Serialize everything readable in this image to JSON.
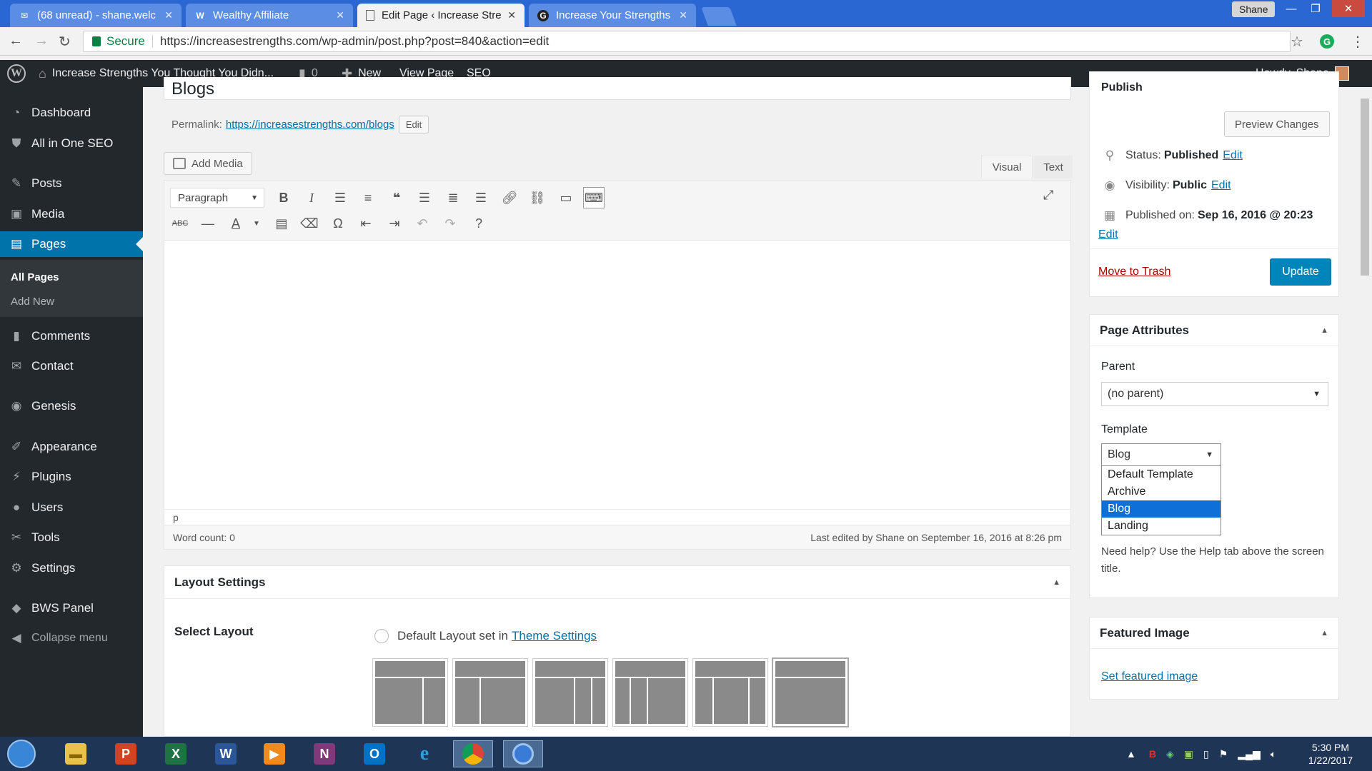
{
  "browser": {
    "tabs": [
      {
        "label": "(68 unread) - shane.welc",
        "icon": "gmail-icon"
      },
      {
        "label": "Wealthy Affiliate",
        "icon": "wa-icon"
      },
      {
        "label": "Edit Page ‹ Increase Stre",
        "icon": "page-icon"
      },
      {
        "label": "Increase Your Strengths",
        "icon": "g-icon"
      }
    ],
    "window_user": "Shane",
    "secure_label": "Secure",
    "url": "https://increasestrengths.com/wp-admin/post.php?post=840&action=edit"
  },
  "adminbar": {
    "site_name": "Increase Strengths You Thought You Didn...",
    "comments_count": "0",
    "new_label": "New",
    "view_page_label": "View Page",
    "seo_label": "SEO",
    "howdy": "Howdy, Shane"
  },
  "sidebar": {
    "items": [
      {
        "label": "Dashboard",
        "icon": "dashboard-icon"
      },
      {
        "label": "All in One SEO",
        "icon": "seo-icon"
      },
      {
        "label": "Posts",
        "icon": "pin-icon"
      },
      {
        "label": "Media",
        "icon": "media-icon"
      },
      {
        "label": "Pages",
        "icon": "pages-icon"
      },
      {
        "label": "Comments",
        "icon": "comment-icon"
      },
      {
        "label": "Contact",
        "icon": "mail-icon"
      },
      {
        "label": "Genesis",
        "icon": "genesis-icon"
      },
      {
        "label": "Appearance",
        "icon": "brush-icon"
      },
      {
        "label": "Plugins",
        "icon": "plugin-icon"
      },
      {
        "label": "Users",
        "icon": "user-icon"
      },
      {
        "label": "Tools",
        "icon": "wrench-icon"
      },
      {
        "label": "Settings",
        "icon": "settings-icon"
      },
      {
        "label": "BWS Panel",
        "icon": "bws-icon"
      }
    ],
    "submenu": [
      "All Pages",
      "Add New"
    ],
    "collapse": "Collapse menu"
  },
  "editor": {
    "title": "Blogs",
    "permalink_label": "Permalink:",
    "permalink_url": "https://increasestrengths.com/blogs",
    "permalink_edit": "Edit",
    "add_media": "Add Media",
    "tab_visual": "Visual",
    "tab_text": "Text",
    "format": "Paragraph",
    "path": "p",
    "word_count": "Word count: 0",
    "last_edited": "Last edited by Shane on September 16, 2016 at 8:26 pm"
  },
  "layout": {
    "title": "Layout Settings",
    "select_label": "Select Layout",
    "default_text": "Default Layout set in",
    "theme_settings_link": "Theme Settings"
  },
  "publish": {
    "title": "Publish",
    "preview": "Preview Changes",
    "status_label": "Status:",
    "status_value": "Published",
    "visibility_label": "Visibility:",
    "visibility_value": "Public",
    "published_label": "Published on:",
    "published_value": "Sep 16, 2016 @ 20:23",
    "edit": "Edit",
    "trash": "Move to Trash",
    "update": "Update"
  },
  "attributes": {
    "title": "Page Attributes",
    "parent_label": "Parent",
    "parent_value": "(no parent)",
    "template_label": "Template",
    "template_value": "Blog",
    "template_options": [
      "Default Template",
      "Archive",
      "Blog",
      "Landing"
    ],
    "selected_option": "Blog",
    "help": "Need help? Use the Help tab above the screen title."
  },
  "featured": {
    "title": "Featured Image",
    "link": "Set featured image"
  },
  "taskbar": {
    "time": "5:30 PM",
    "date": "1/22/2017"
  },
  "colors": {
    "wp_blue": "#0073aa",
    "admin_dark": "#23282d",
    "chrome_blue": "#2b67d3",
    "selected_option": "#0e6fd8"
  }
}
